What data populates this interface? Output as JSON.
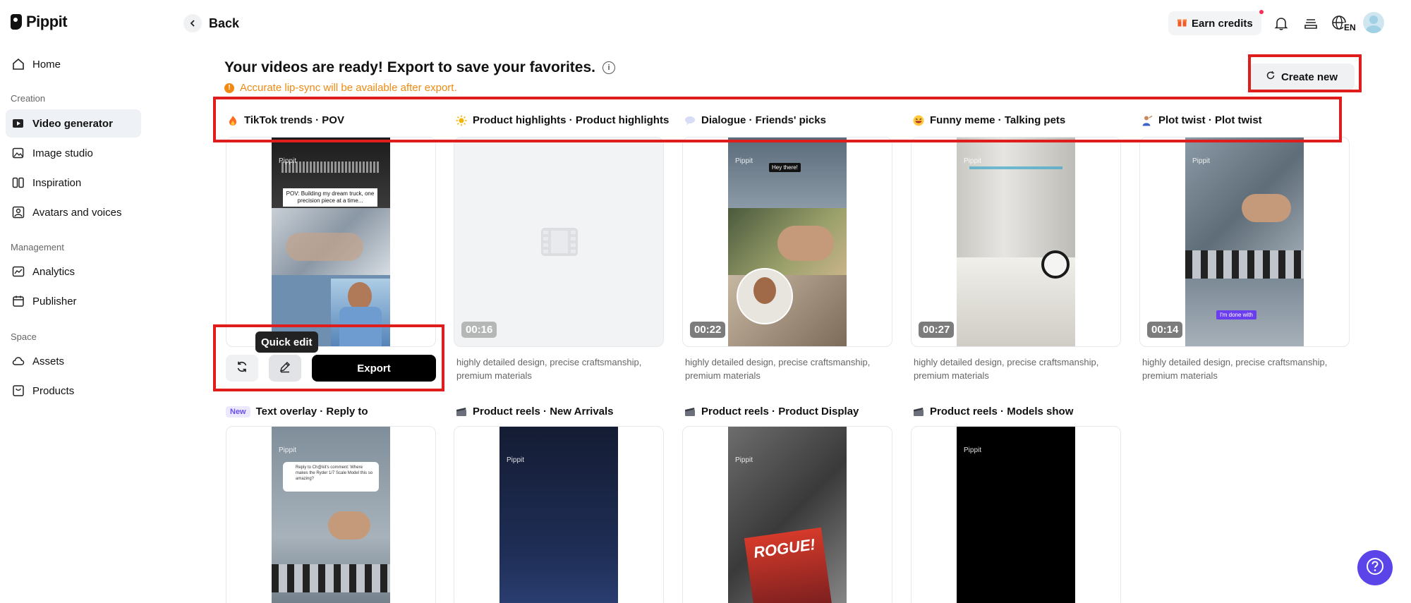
{
  "app": {
    "name": "Pippit"
  },
  "sidebar": {
    "sections": {
      "creation": "Creation",
      "management": "Management",
      "space": "Space"
    },
    "items": [
      {
        "label": "Home"
      },
      {
        "label": "Video generator"
      },
      {
        "label": "Image studio"
      },
      {
        "label": "Inspiration"
      },
      {
        "label": "Avatars and voices"
      },
      {
        "label": "Analytics"
      },
      {
        "label": "Publisher"
      },
      {
        "label": "Assets"
      },
      {
        "label": "Products"
      }
    ]
  },
  "topbar": {
    "back_label": "Back",
    "earn_credits": "Earn credits",
    "lang": "EN"
  },
  "main": {
    "heading": "Your videos are ready! Export to save your favorites.",
    "warning": "Accurate lip-sync will be available after export.",
    "create_new": "Create new",
    "categories_row1": [
      {
        "emoji": "fire-icon",
        "label": "TikTok trends · POV"
      },
      {
        "emoji": "sparkle-icon",
        "label": "Product highlights · Product highlights"
      },
      {
        "emoji": "speech-bubble-icon",
        "label": "Dialogue · Friends' picks"
      },
      {
        "emoji": "laughing-face-icon",
        "label": "Funny meme · Talking pets"
      },
      {
        "emoji": "person-icon",
        "label": "Plot twist · Plot twist"
      }
    ],
    "cards_row1": [
      {
        "duration": "",
        "desc": "",
        "overlay": "POV: Building my dream truck, one precision piece at a time..."
      },
      {
        "duration": "00:16",
        "desc": "highly detailed design, precise craftsmanship, premium materials",
        "overlay": ""
      },
      {
        "duration": "00:22",
        "desc": "highly detailed design, precise craftsmanship, premium materials",
        "overlay": "Hey there!"
      },
      {
        "duration": "00:27",
        "desc": "highly detailed design, precise craftsmanship, premium materials",
        "overlay": ""
      },
      {
        "duration": "00:14",
        "desc": "highly detailed design, precise craftsmanship, premium materials",
        "overlay": "I'm done with"
      }
    ],
    "watermark": "Pippit",
    "actions": {
      "tooltip": "Quick edit",
      "export": "Export"
    },
    "categories_row2": [
      {
        "badge": "New",
        "emoji": "",
        "label": "Text overlay · Reply to"
      },
      {
        "badge": "",
        "emoji": "film-icon",
        "label": "Product reels · New Arrivals"
      },
      {
        "badge": "",
        "emoji": "film-icon",
        "label": "Product reels · Product Display"
      },
      {
        "badge": "",
        "emoji": "film-icon",
        "label": "Product reels · Models show"
      }
    ],
    "cards_row2": [
      {
        "overlay": "Reply to Ch@kit's comment: Where makes the Ryder 1/7 Scale Model this so amazing?"
      },
      {
        "overlay": ""
      },
      {
        "overlay": "ROGUE!"
      },
      {
        "overlay": ""
      }
    ]
  },
  "colors": {
    "accent": "#5b44e8",
    "warning": "#f08a12",
    "highlight": "#e01d1d"
  }
}
